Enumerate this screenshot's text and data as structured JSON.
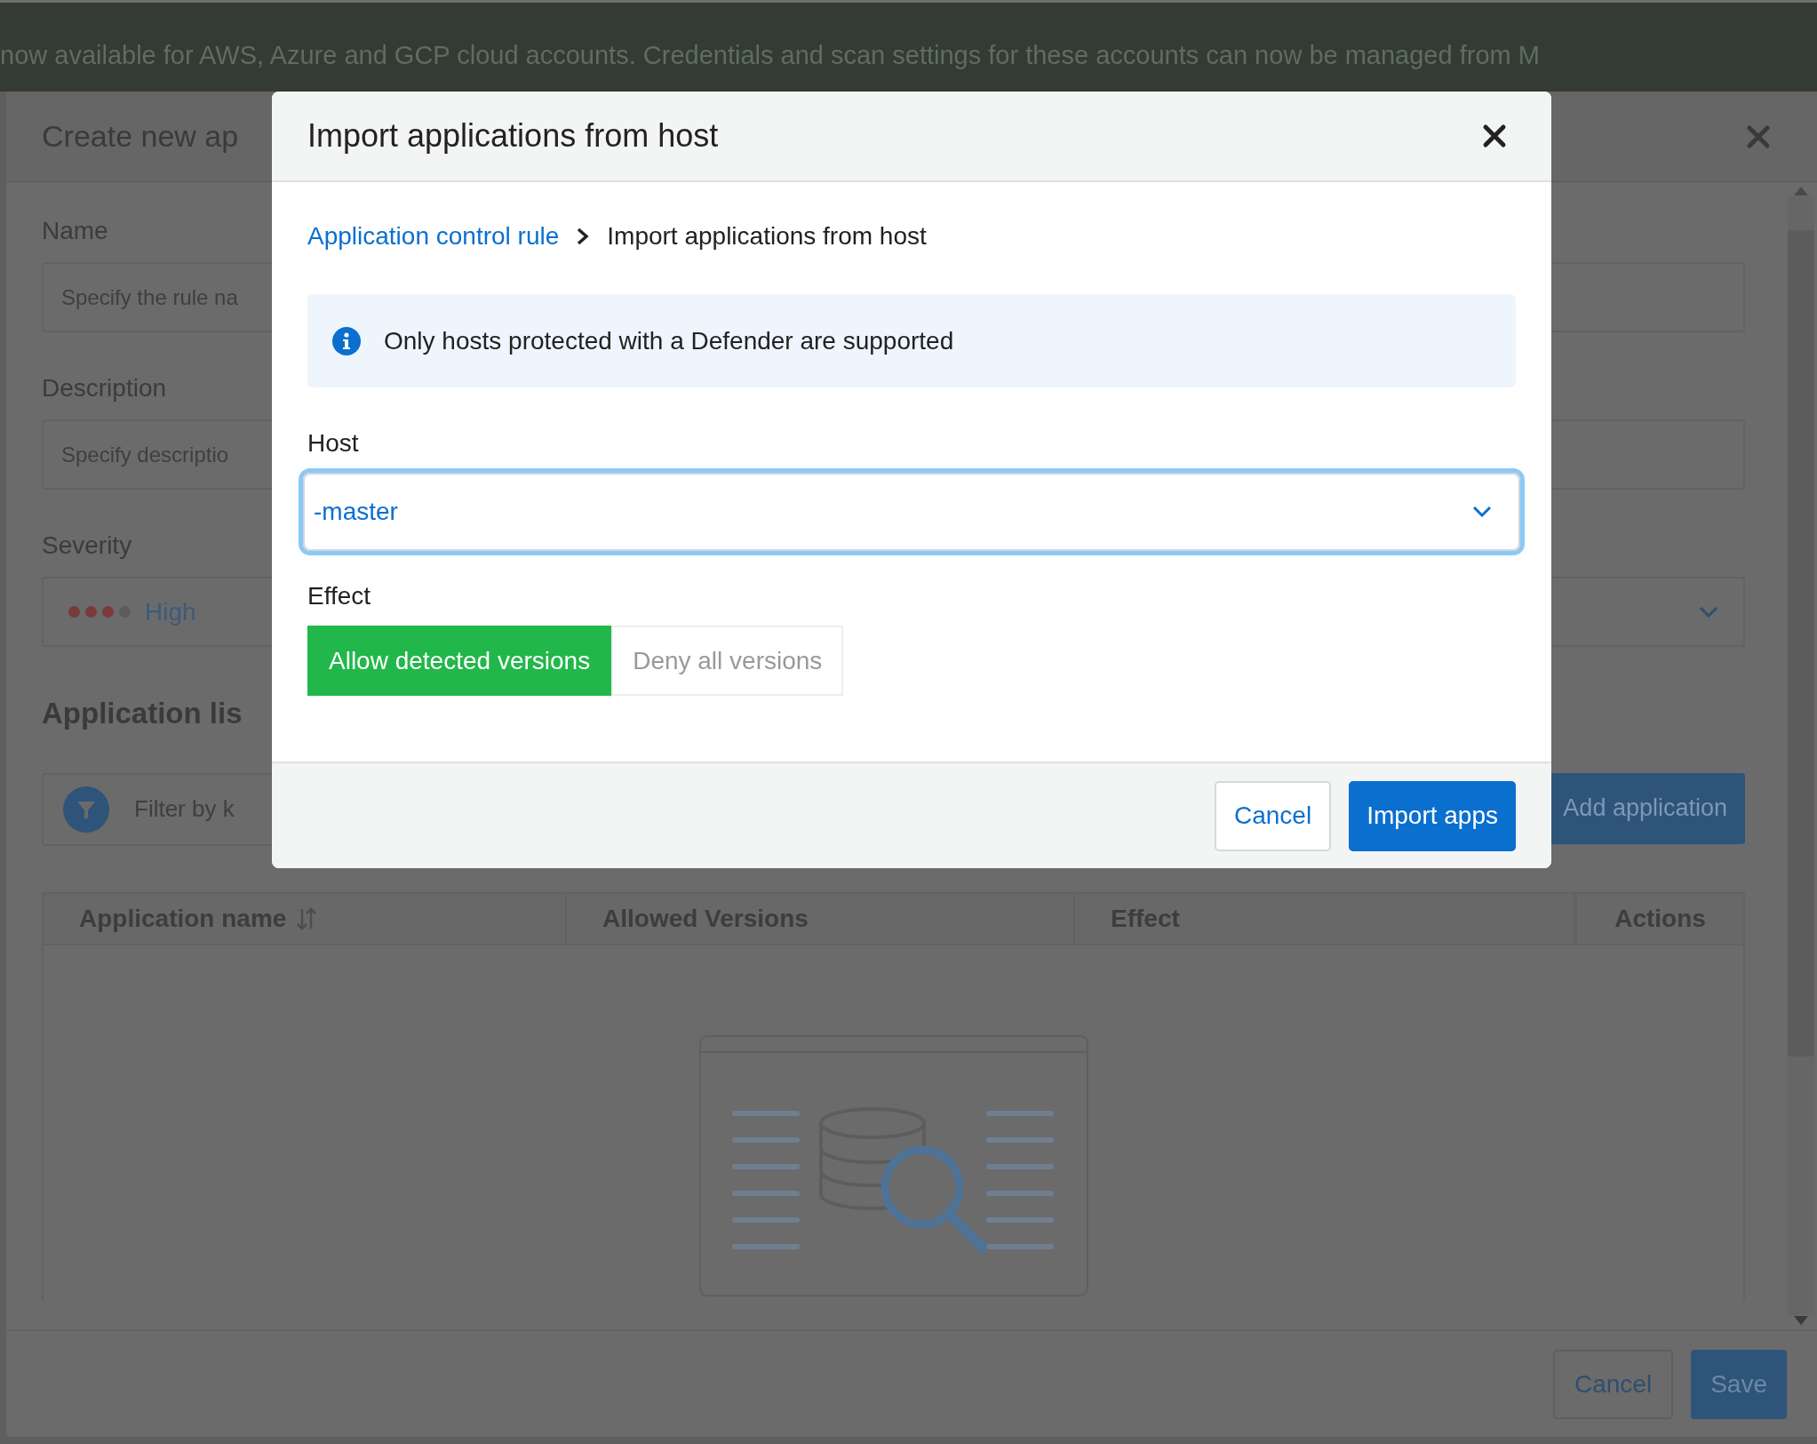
{
  "banner": {
    "text": "now available for AWS, Azure and GCP cloud accounts. Credentials and scan settings for these accounts can now be managed from M"
  },
  "background_dialog": {
    "title": "Create new ap",
    "fields": [
      {
        "label": "Name",
        "placeholder": "Specify the rule na"
      },
      {
        "label": "Description",
        "placeholder": "Specify descriptio"
      }
    ],
    "severity": {
      "label": "Severity",
      "value": "High",
      "stars": 3
    },
    "application_list": {
      "title": "Application lis",
      "filter_placeholder": "Filter by k",
      "add_button": "Add application",
      "columns": [
        {
          "label": "Application name",
          "sortable": true
        },
        {
          "label": "Allowed Versions",
          "sortable": false
        },
        {
          "label": "Effect",
          "sortable": false
        },
        {
          "label": "Actions",
          "sortable": false
        }
      ]
    },
    "buttons": [
      {
        "label": "Cancel",
        "kind": "secondary"
      },
      {
        "label": "Save",
        "kind": "primary"
      }
    ]
  },
  "dialog": {
    "title": "Import applications from host",
    "breadcrumb": [
      {
        "label": "Application control rule",
        "kind": "link"
      },
      {
        "label": "Import applications from host",
        "kind": "current"
      }
    ],
    "info": "Only hosts protected with a Defender are supported",
    "host": {
      "label": "Host",
      "value": "-master",
      "focused": true
    },
    "effect": {
      "label": "Effect",
      "options": [
        {
          "label": "Allow detected versions",
          "selected": true
        },
        {
          "label": "Deny all versions",
          "selected": false
        }
      ]
    },
    "buttons": [
      {
        "label": "Cancel",
        "kind": "secondary"
      },
      {
        "label": "Import apps",
        "kind": "primary"
      }
    ]
  }
}
